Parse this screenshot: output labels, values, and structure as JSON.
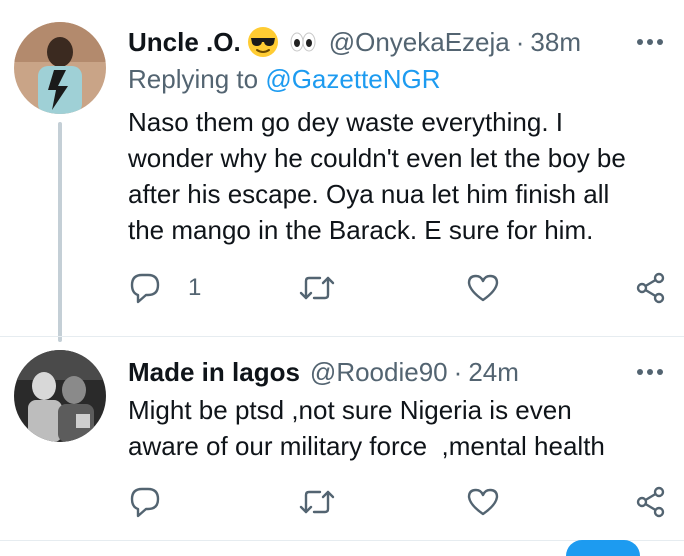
{
  "tweets": [
    {
      "display_name": "Uncle .O.",
      "emojis": [
        "😎",
        "👀"
      ],
      "handle": "@OnyekaEzeja",
      "separator": "·",
      "time": "38m",
      "replying_prefix": "Replying to",
      "replying_to": "@GazetteNGR",
      "body_lines": [
        "Naso them go dey waste everything. I",
        "wonder why he couldn't even let the boy be",
        "after his escape. Oya nua let him finish all",
        "the mango in the Barack. E sure for him."
      ],
      "reply_count": "1",
      "icons": [
        "avatar",
        "more-icon",
        "reply-icon",
        "retweet-icon",
        "like-icon",
        "share-icon"
      ]
    },
    {
      "display_name": "Made in lagos",
      "handle": "@Roodie90",
      "separator": "·",
      "time": "24m",
      "body_lines": [
        "Might be ptsd ,not sure Nigeria is even",
        "aware of our military force  ,mental health"
      ],
      "reply_count": "",
      "icons": [
        "avatar",
        "more-icon",
        "reply-icon",
        "retweet-icon",
        "like-icon",
        "share-icon"
      ]
    }
  ],
  "colors": {
    "text": "#0f1419",
    "secondary": "#536471",
    "link": "#1d9bf0",
    "thread_line": "#c4cfd6"
  }
}
